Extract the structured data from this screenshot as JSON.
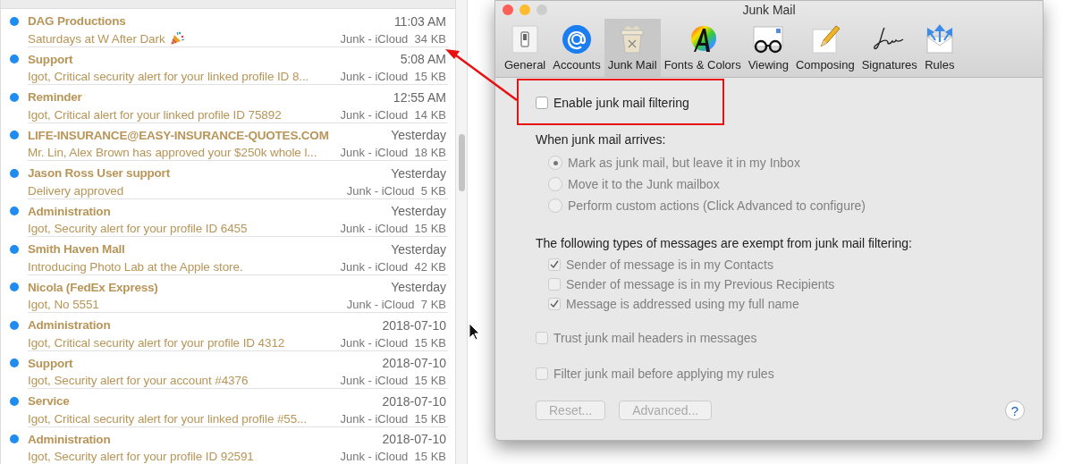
{
  "messages": [
    {
      "sender": "DAG Productions",
      "time": "11:03 AM",
      "subject": "Saturdays at W After Dark",
      "party_emoji": true,
      "mailbox": "Junk - iCloud",
      "size": "34 KB",
      "unread": true
    },
    {
      "sender": "Support",
      "time": "5:08 AM",
      "subject": "Igot, Critical security alert for your linked profile ID 8...",
      "mailbox": "Junk - iCloud",
      "size": "15 KB",
      "unread": true
    },
    {
      "sender": "Reminder",
      "time": "12:55 AM",
      "subject": "Igot, Critical alert for your linked profile ID 75892",
      "mailbox": "Junk - iCloud",
      "size": "14 KB",
      "unread": true
    },
    {
      "sender": "LIFE-INSURANCE@EASY-INSURANCE-QUOTES.COM",
      "time": "Yesterday",
      "subject": "Mr. Lin, Alex Brown has approved your $250k whole l...",
      "mailbox": "Junk - iCloud",
      "size": "18 KB",
      "unread": true
    },
    {
      "sender": "Jason Ross User support",
      "time": "Yesterday",
      "subject": "Delivery approved",
      "mailbox": "Junk - iCloud",
      "size": "5 KB",
      "unread": true
    },
    {
      "sender": "Administration",
      "time": "Yesterday",
      "subject": "Igot, Security alert for your profile ID 6455",
      "mailbox": "Junk - iCloud",
      "size": "15 KB",
      "unread": true
    },
    {
      "sender": "Smith Haven Mall",
      "time": "Yesterday",
      "subject": "Introducing Photo Lab at the Apple store.",
      "mailbox": "Junk - iCloud",
      "size": "42 KB",
      "unread": true
    },
    {
      "sender": "Nicola (FedEx Express)",
      "time": "Yesterday",
      "subject": "Igot, No 5551",
      "mailbox": "Junk - iCloud",
      "size": "7 KB",
      "unread": true
    },
    {
      "sender": "Administration",
      "time": "2018-07-10",
      "subject": "Igot, Critical security alert for your profile ID 4312",
      "mailbox": "Junk - iCloud",
      "size": "15 KB",
      "unread": true
    },
    {
      "sender": "Support",
      "time": "2018-07-10",
      "subject": "Igot, Security alert for your account #4376",
      "mailbox": "Junk - iCloud",
      "size": "15 KB",
      "unread": true
    },
    {
      "sender": "Service",
      "time": "2018-07-10",
      "subject": "Igot, Critical security alert for your linked profile #55...",
      "mailbox": "Junk - iCloud",
      "size": "15 KB",
      "unread": true
    },
    {
      "sender": "Administration",
      "time": "2018-07-10",
      "subject": "Igot, Security alert for your profile ID 92591",
      "mailbox": "Junk - iCloud",
      "size": "15 KB",
      "unread": true
    }
  ],
  "window": {
    "title": "Junk Mail",
    "tabs": [
      {
        "label": "General",
        "kind": "general",
        "selected": false
      },
      {
        "label": "Accounts",
        "kind": "accounts",
        "selected": false
      },
      {
        "label": "Junk Mail",
        "kind": "junk",
        "selected": true
      },
      {
        "label": "Fonts & Colors",
        "kind": "fonts",
        "selected": false
      },
      {
        "label": "Viewing",
        "kind": "viewing",
        "selected": false
      },
      {
        "label": "Composing",
        "kind": "composing",
        "selected": false
      },
      {
        "label": "Signatures",
        "kind": "signatures",
        "selected": false
      },
      {
        "label": "Rules",
        "kind": "rules",
        "selected": false
      }
    ],
    "enable": {
      "label": "Enable junk mail filtering",
      "checked": false
    },
    "arrives_heading": "When junk mail arrives:",
    "actions": [
      {
        "label": "Mark as junk mail, but leave it in my Inbox",
        "selected": true,
        "disabled": true
      },
      {
        "label": "Move it to the Junk mailbox",
        "selected": false,
        "disabled": true
      },
      {
        "label": "Perform custom actions (Click Advanced to configure)",
        "selected": false,
        "disabled": true
      }
    ],
    "exempt_heading": "The following types of messages are exempt from junk mail filtering:",
    "exemptions": [
      {
        "label": "Sender of message is in my Contacts",
        "checked": true,
        "disabled": true
      },
      {
        "label": "Sender of message is in my Previous Recipients",
        "checked": false,
        "disabled": true
      },
      {
        "label": "Message is addressed using my full name",
        "checked": true,
        "disabled": true
      }
    ],
    "options": [
      {
        "label": "Trust junk mail headers in messages",
        "checked": false,
        "disabled": true
      },
      {
        "label": "Filter junk mail before applying my rules",
        "checked": false,
        "disabled": true
      }
    ],
    "buttons": [
      {
        "label": "Reset...",
        "disabled": true
      },
      {
        "label": "Advanced...",
        "disabled": true
      }
    ],
    "help": "?"
  }
}
